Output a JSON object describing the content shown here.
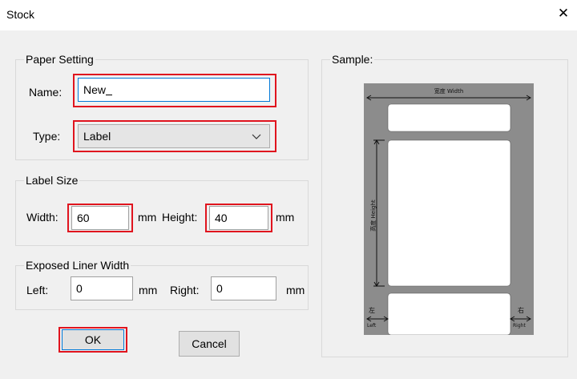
{
  "window": {
    "title": "Stock",
    "close_glyph": "✕"
  },
  "paper_setting": {
    "legend": "Paper Setting",
    "name_label": "Name:",
    "name_value": "New",
    "type_label": "Type:",
    "type_value": "Label"
  },
  "label_size": {
    "legend": "Label Size",
    "width_label": "Width:",
    "width_value": "60",
    "width_unit": "mm",
    "height_label": "Height:",
    "height_value": "40",
    "height_unit": "mm"
  },
  "liner": {
    "legend": "Exposed Liner Width",
    "left_label": "Left:",
    "left_value": "0",
    "left_unit": "mm",
    "right_label": "Right:",
    "right_value": "0",
    "right_unit": "mm"
  },
  "buttons": {
    "ok": "OK",
    "cancel": "Cancel"
  },
  "sample": {
    "legend": "Sample:",
    "width_text": "宽度 Width",
    "height_text": "高度 Height",
    "left_cn": "左",
    "left_en": "Left",
    "right_cn": "右",
    "right_en": "Right"
  },
  "colors": {
    "highlight": "#e0141e",
    "sample_gray": "#8c8c8c",
    "accent_focus": "#0078d7"
  }
}
